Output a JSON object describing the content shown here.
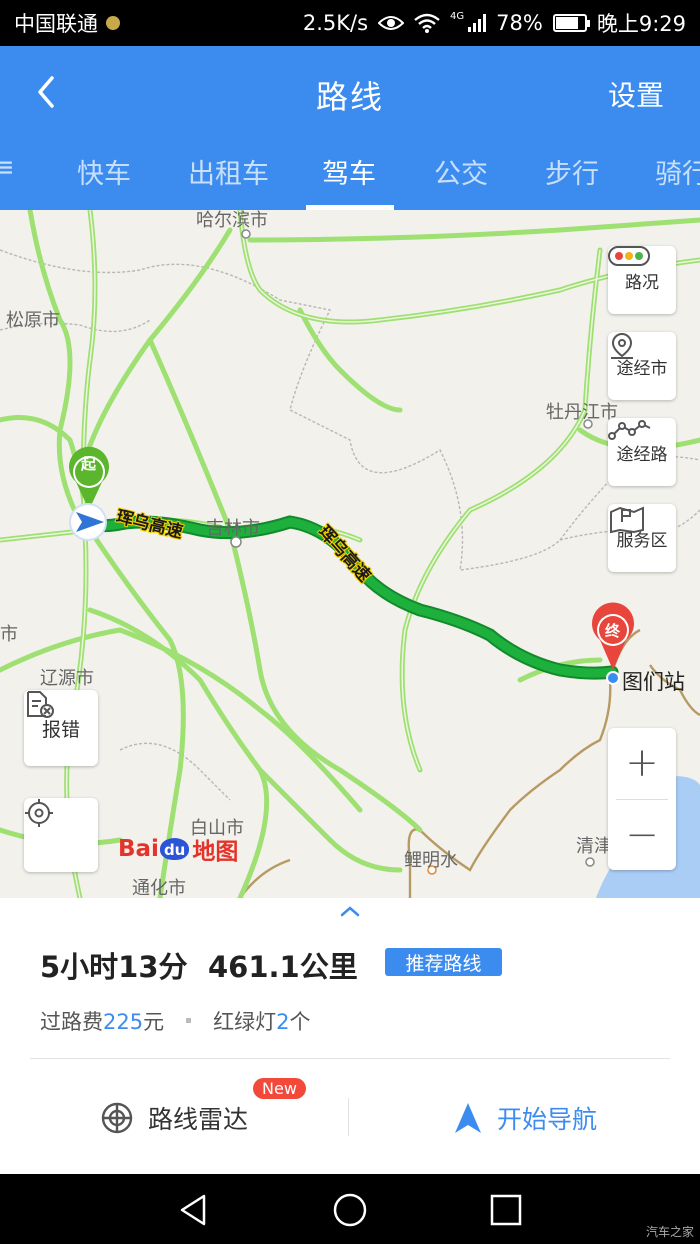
{
  "status_bar": {
    "carrier": "中国联通",
    "network_speed": "2.5K/s",
    "network_type": "4G",
    "battery": "78%",
    "battery_level": 0.78,
    "time": "晚上9:29"
  },
  "header": {
    "title": "路线",
    "settings_label": "设置",
    "tabs": [
      {
        "label": "快车"
      },
      {
        "label": "出租车"
      },
      {
        "label": "驾车"
      },
      {
        "label": "公交"
      },
      {
        "label": "步行"
      },
      {
        "label": "骑行"
      }
    ],
    "active_tab": "驾车"
  },
  "map": {
    "cities": {
      "harbin": "哈尔滨市",
      "songyuan": "松原市",
      "mudanjiang": "牡丹江市",
      "jilin": "吉林市",
      "liaoyuan": "辽源市",
      "baishan": "白山市",
      "tonghua": "通化市",
      "qingjin": "清津",
      "lijingshui": "鲤明水",
      "edge": "市"
    },
    "highway_name": "珲乌高速",
    "start_label": "起",
    "end_label": "终",
    "destination": "图们站",
    "side_buttons": {
      "traffic": "路况",
      "via_city": "途经市",
      "via_road": "途经路",
      "service_area": "服务区"
    },
    "report_label": "报错",
    "zoom_in": "+",
    "zoom_out": "−",
    "logo": {
      "text_a": "Bai",
      "text_b": "du",
      "text_c": "地图"
    },
    "route_color": "#1db03c"
  },
  "route_summary": {
    "duration": "5小时13分",
    "distance": "461.1公里",
    "tag": "推荐路线",
    "toll_prefix": "过路费",
    "toll_value": "225",
    "toll_unit": "元",
    "lights_prefix": "红绿灯",
    "lights_value": "2",
    "lights_unit": "个"
  },
  "actions": {
    "radar_label": "路线雷达",
    "new_badge": "New",
    "navigate_label": "开始导航"
  },
  "watermark": "汽车之家",
  "colors": {
    "primary": "#3c8cf0",
    "badge_red": "#f2493b",
    "route_green": "#1db03c",
    "start_green": "#5bb52d",
    "end_red": "#e8453c"
  }
}
